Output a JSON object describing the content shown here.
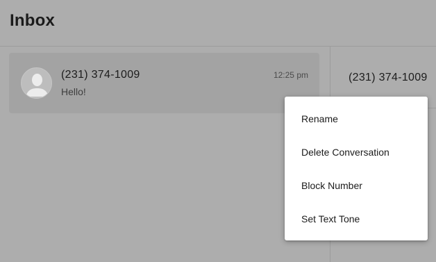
{
  "header": {
    "title": "Inbox"
  },
  "conversations": [
    {
      "name": "(231) 374-1009",
      "preview": "Hello!",
      "time": "12:25 pm",
      "avatar_icon": "person-icon"
    }
  ],
  "detail": {
    "name": "(231) 374-1009"
  },
  "context_menu": {
    "items": [
      {
        "label": "Rename"
      },
      {
        "label": "Delete Conversation"
      },
      {
        "label": "Block Number"
      },
      {
        "label": "Set Text Tone"
      }
    ]
  },
  "colors": {
    "background": "#adadad",
    "selected_item": "#a3a3a3",
    "menu_background": "#ffffff",
    "text": "#1b1b1b"
  }
}
